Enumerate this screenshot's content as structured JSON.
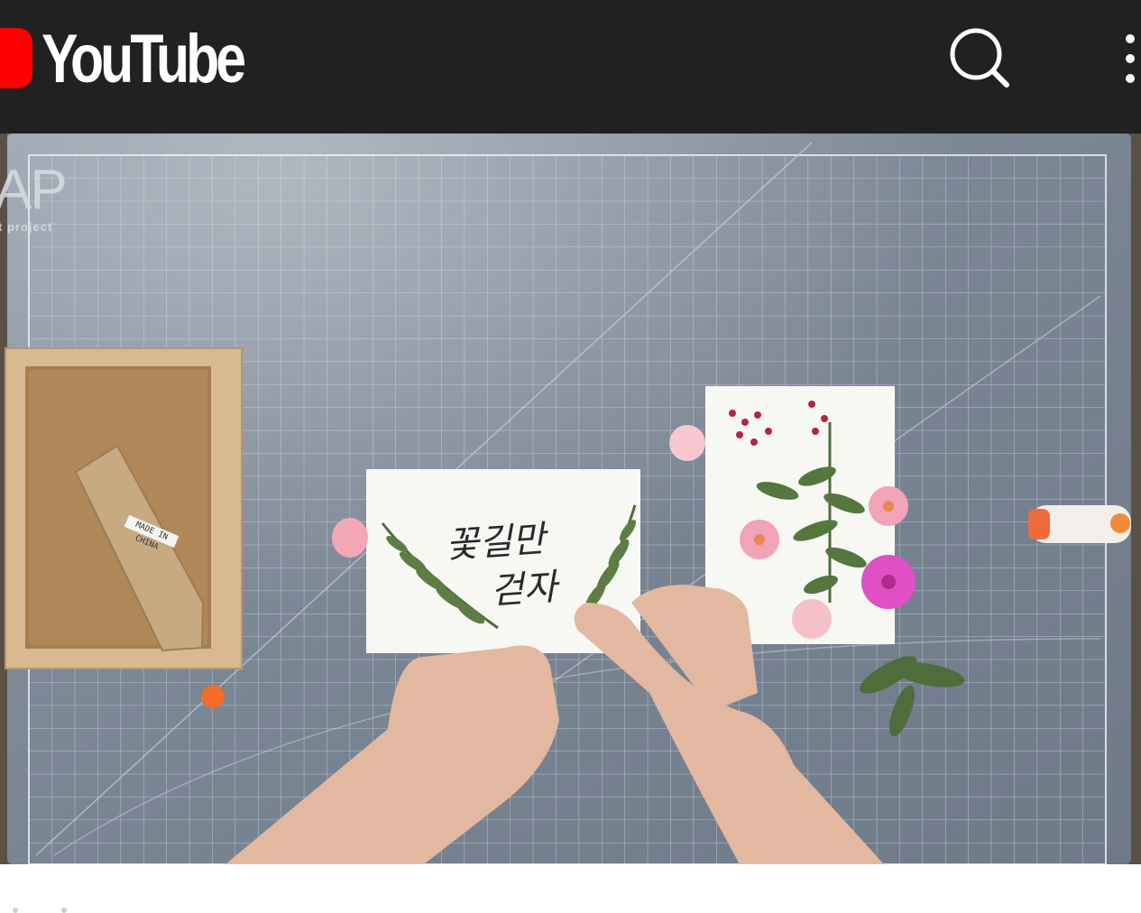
{
  "app": {
    "name": "YouTube"
  },
  "header": {
    "logo_text": "YouTube",
    "search_icon": "search-icon",
    "more_icon": "more-vertical-icon"
  },
  "video": {
    "watermark_big": "AP",
    "watermark_small": "t project",
    "card_line1": "꽃길만",
    "card_line2": "걷자",
    "frame_label": "MADE IN CHINA"
  },
  "colors": {
    "appbar_bg": "#212121",
    "brand_red": "#ff0000",
    "mat_blue": "#7c8797",
    "grid_line": "#b7c0cc"
  }
}
